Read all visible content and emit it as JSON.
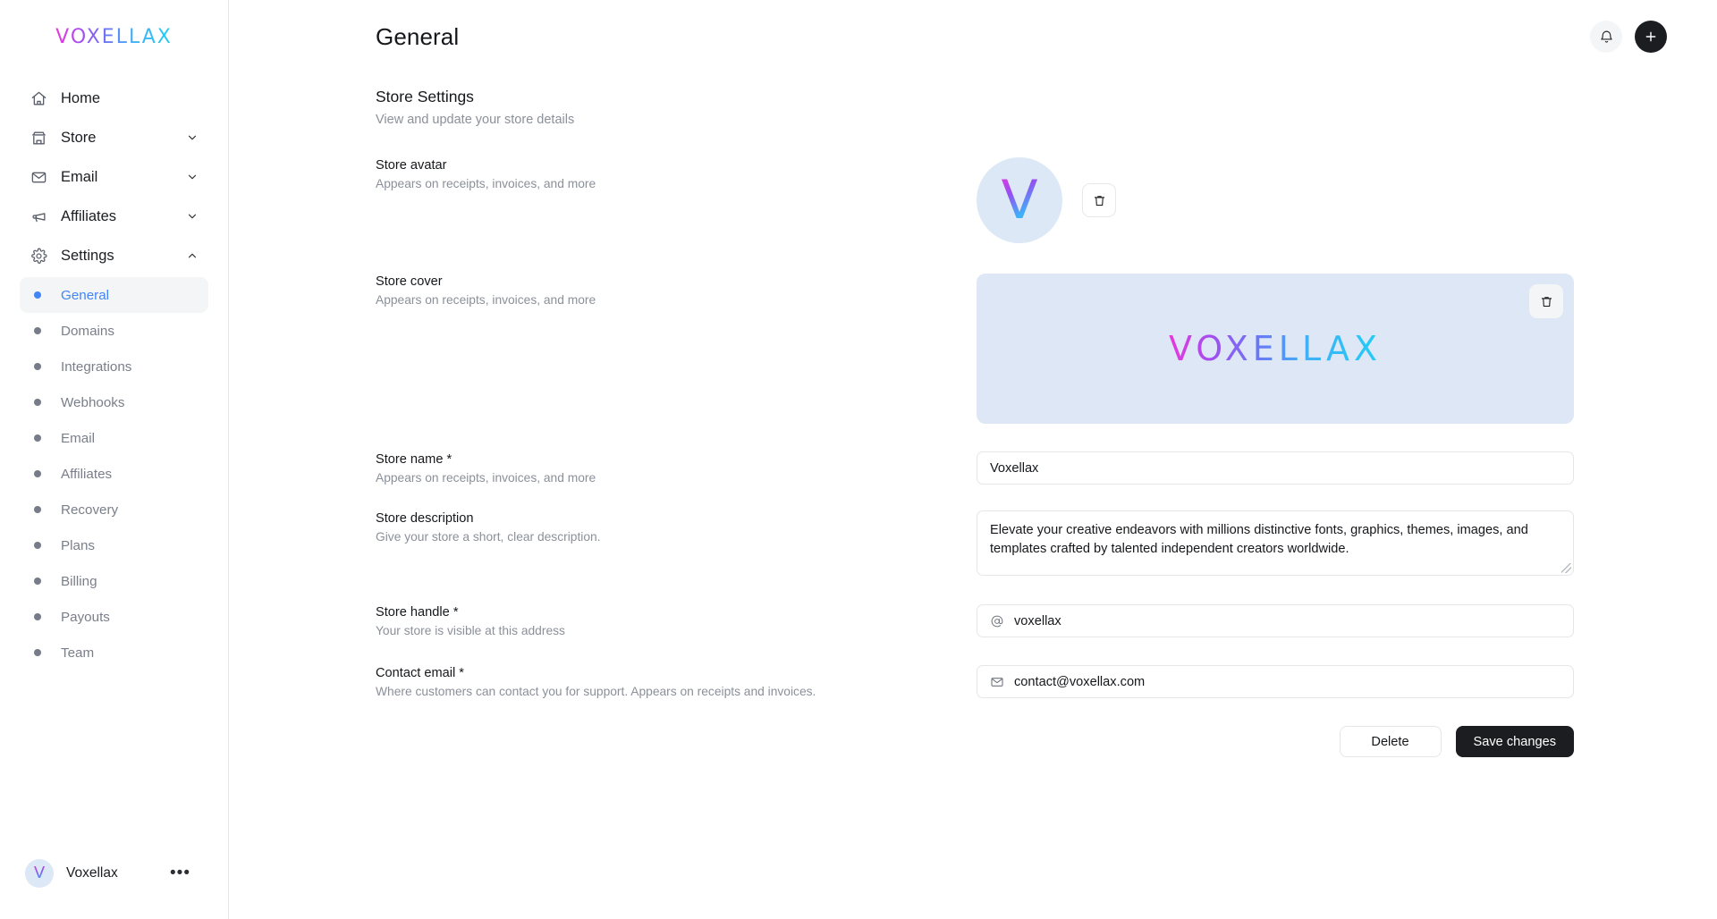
{
  "brand": {
    "name": "VOXELLAX"
  },
  "sidebar": {
    "nav": [
      {
        "label": "Home",
        "icon": "home-icon",
        "expandable": false
      },
      {
        "label": "Store",
        "icon": "storefront-icon",
        "expandable": true,
        "chevron": "chevron-down-icon"
      },
      {
        "label": "Email",
        "icon": "envelope-icon",
        "expandable": true,
        "chevron": "chevron-down-icon"
      },
      {
        "label": "Affiliates",
        "icon": "megaphone-icon",
        "expandable": true,
        "chevron": "chevron-down-icon"
      },
      {
        "label": "Settings",
        "icon": "gear-icon",
        "expandable": true,
        "chevron": "chevron-up-icon"
      }
    ],
    "subnav": [
      {
        "label": "General",
        "active": true
      },
      {
        "label": "Domains",
        "active": false
      },
      {
        "label": "Integrations",
        "active": false
      },
      {
        "label": "Webhooks",
        "active": false
      },
      {
        "label": "Email",
        "active": false
      },
      {
        "label": "Affiliates",
        "active": false
      },
      {
        "label": "Recovery",
        "active": false
      },
      {
        "label": "Plans",
        "active": false
      },
      {
        "label": "Billing",
        "active": false
      },
      {
        "label": "Payouts",
        "active": false
      },
      {
        "label": "Team",
        "active": false
      }
    ],
    "account": {
      "name": "Voxellax",
      "avatar_letter": "V",
      "more_label": "•••"
    }
  },
  "topbar": {
    "title": "General",
    "notifications_icon": "bell-icon",
    "add_icon": "plus-icon",
    "add_label": "+"
  },
  "section": {
    "title": "Store Settings",
    "subtitle": "View and update your store details"
  },
  "fields": {
    "avatar": {
      "label": "Store avatar",
      "hint": "Appears on receipts, invoices, and more",
      "avatar_letter": "V",
      "delete_icon": "trash-icon"
    },
    "cover": {
      "label": "Store cover",
      "hint": "Appears on receipts, invoices, and more",
      "cover_text": "VOXELLAX",
      "delete_icon": "trash-icon"
    },
    "store_name": {
      "label": "Store name *",
      "hint": "Appears on receipts, invoices, and more",
      "value": "Voxellax",
      "placeholder": "Store name"
    },
    "store_description": {
      "label": "Store description",
      "hint": "Give your store a short, clear description.",
      "value": "Elevate your creative endeavors with millions distinctive fonts, graphics, themes, images, and templates crafted by talented independent creators worldwide.",
      "placeholder": "Store description"
    },
    "store_handle": {
      "label": "Store handle *",
      "hint": "Your store is visible at this address",
      "value": "voxellax",
      "placeholder": "handle",
      "prefix_icon": "at-sign-icon"
    },
    "contact_email": {
      "label": "Contact email *",
      "hint": "Where customers can contact you for support. Appears on receipts and invoices.",
      "value": "contact@voxellax.com",
      "placeholder": "email",
      "prefix_icon": "envelope-icon"
    }
  },
  "actions": {
    "delete_label": "Delete",
    "save_label": "Save changes"
  },
  "colors": {
    "accent_blue": "#4285f4",
    "brand_gradient_start": "#e838dd",
    "brand_gradient_end": "#22cdf5",
    "cover_bg": "#dde7f6",
    "avatar_bg": "#dce8f6",
    "primary_button_bg": "#1b1d21",
    "border": "#e4e6ea",
    "muted_text": "#8b9099"
  }
}
